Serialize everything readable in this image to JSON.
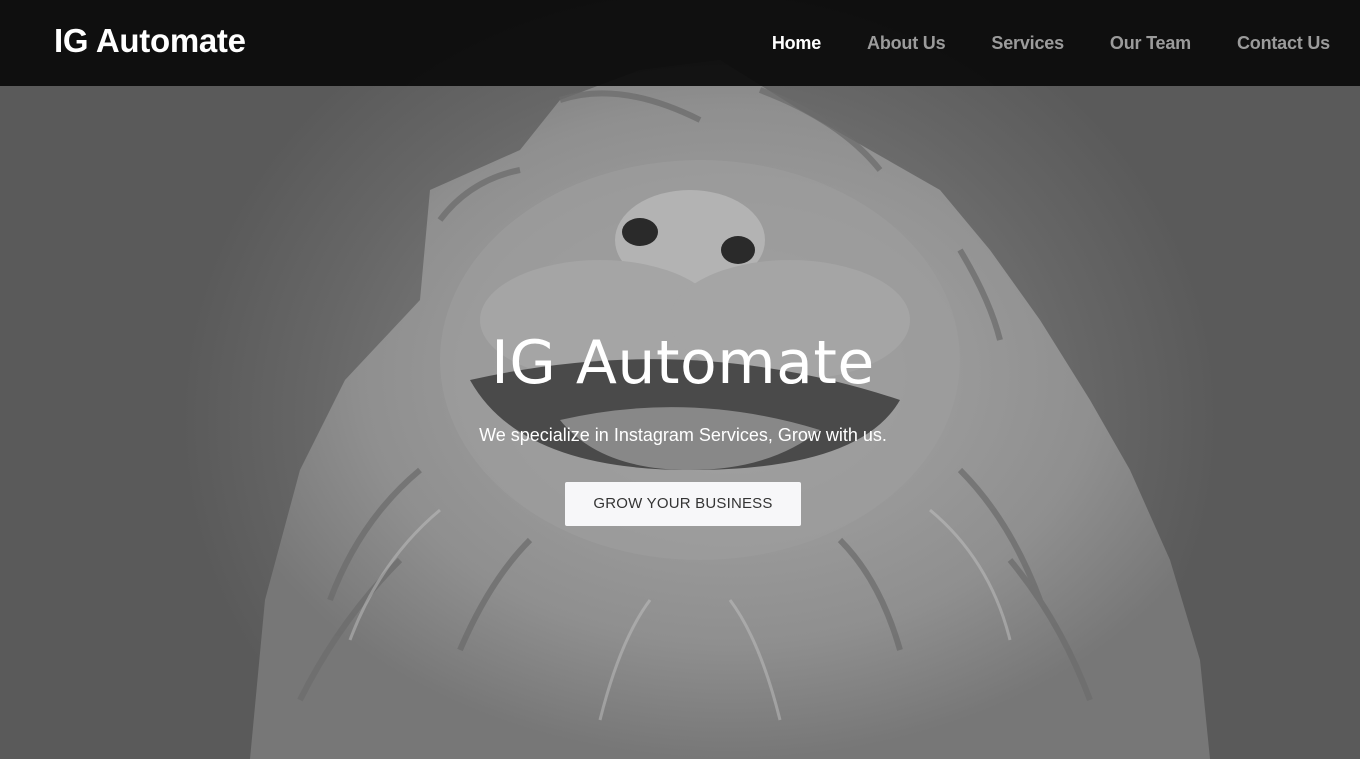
{
  "navbar": {
    "brand": "IG Automate",
    "items": [
      {
        "label": "Home",
        "active": true
      },
      {
        "label": "About Us",
        "active": false
      },
      {
        "label": "Services",
        "active": false
      },
      {
        "label": "Our Team",
        "active": false
      },
      {
        "label": "Contact Us",
        "active": false
      }
    ]
  },
  "hero": {
    "background_image": "lion-statue-photo",
    "title": "IG Automate",
    "subtitle": "We specialize in Instagram Services, Grow with us.",
    "cta_label": "GROW YOUR BUSINESS"
  },
  "colors": {
    "navbar_bg": "#0a0a0a",
    "nav_active": "#ffffff",
    "nav_inactive": "#9b9b9b",
    "button_bg": "#f7f7f9",
    "button_text": "#343434"
  }
}
